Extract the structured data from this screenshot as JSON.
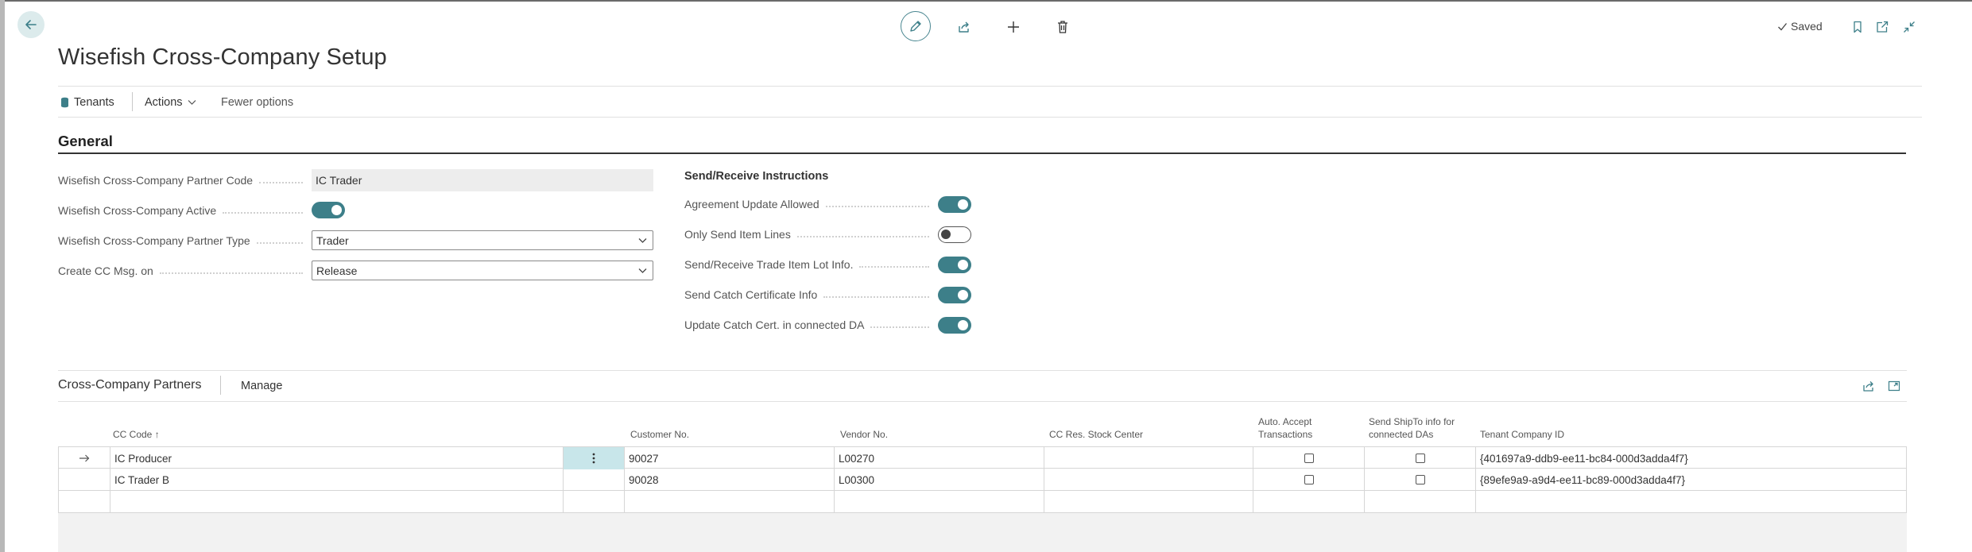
{
  "page": {
    "title": "Wisefish Cross-Company Setup",
    "status": "Saved"
  },
  "actions": {
    "tenants": "Tenants",
    "actions": "Actions",
    "fewer_options": "Fewer options"
  },
  "general": {
    "title": "General",
    "fields": {
      "partner_code": {
        "label": "Wisefish Cross-Company Partner Code",
        "value": "IC Trader"
      },
      "active": {
        "label": "Wisefish Cross-Company Active",
        "value": true
      },
      "partner_type": {
        "label": "Wisefish Cross-Company Partner Type",
        "value": "Trader"
      },
      "create_msg": {
        "label": "Create CC Msg. on",
        "value": "Release"
      }
    },
    "send_receive": {
      "title": "Send/Receive Instructions",
      "items": [
        {
          "label": "Agreement Update Allowed",
          "value": true
        },
        {
          "label": "Only Send Item Lines",
          "value": false
        },
        {
          "label": "Send/Receive Trade Item Lot Info.",
          "value": true
        },
        {
          "label": "Send Catch Certificate Info",
          "value": true
        },
        {
          "label": "Update Catch Cert. in connected DA",
          "value": true
        }
      ]
    }
  },
  "partners": {
    "title": "Cross-Company Partners",
    "manage": "Manage",
    "columns": {
      "cc_code": "CC Code",
      "sort_arrow": "↑",
      "customer_no": "Customer No.",
      "vendor_no": "Vendor No.",
      "cc_res_stock": "CC Res. Stock Center",
      "auto_accept": "Auto. Accept Transactions",
      "send_shipto": "Send ShipTo info for connected DAs",
      "tenant_company_id": "Tenant Company ID"
    },
    "rows": [
      {
        "cc_code": "IC Producer",
        "customer_no": "90027",
        "vendor_no": "L00270",
        "cc_res_stock": "",
        "auto_accept": false,
        "send_shipto": false,
        "tenant_company_id": "{401697a9-ddb9-ee11-bc84-000d3adda4f7}"
      },
      {
        "cc_code": "IC Trader B",
        "customer_no": "90028",
        "vendor_no": "L00300",
        "cc_res_stock": "",
        "auto_accept": false,
        "send_shipto": false,
        "tenant_company_id": "{89efe9a9-a9d4-ee11-bc89-000d3adda4f7}"
      }
    ]
  },
  "icons": {
    "back": "arrow-left-icon",
    "edit": "pencil-icon",
    "share": "share-icon",
    "new": "plus-icon",
    "delete": "trash-icon",
    "bookmark": "bookmark-icon",
    "open_new": "open-in-new-window-icon",
    "collapse": "collapse-icon",
    "tenants": "database-icon",
    "current_row": "arrow-right-icon",
    "row_menu": "vertical-ellipsis-icon"
  },
  "colors": {
    "accent": "#3d7f89",
    "selected_cell": "#c8e6ea"
  }
}
